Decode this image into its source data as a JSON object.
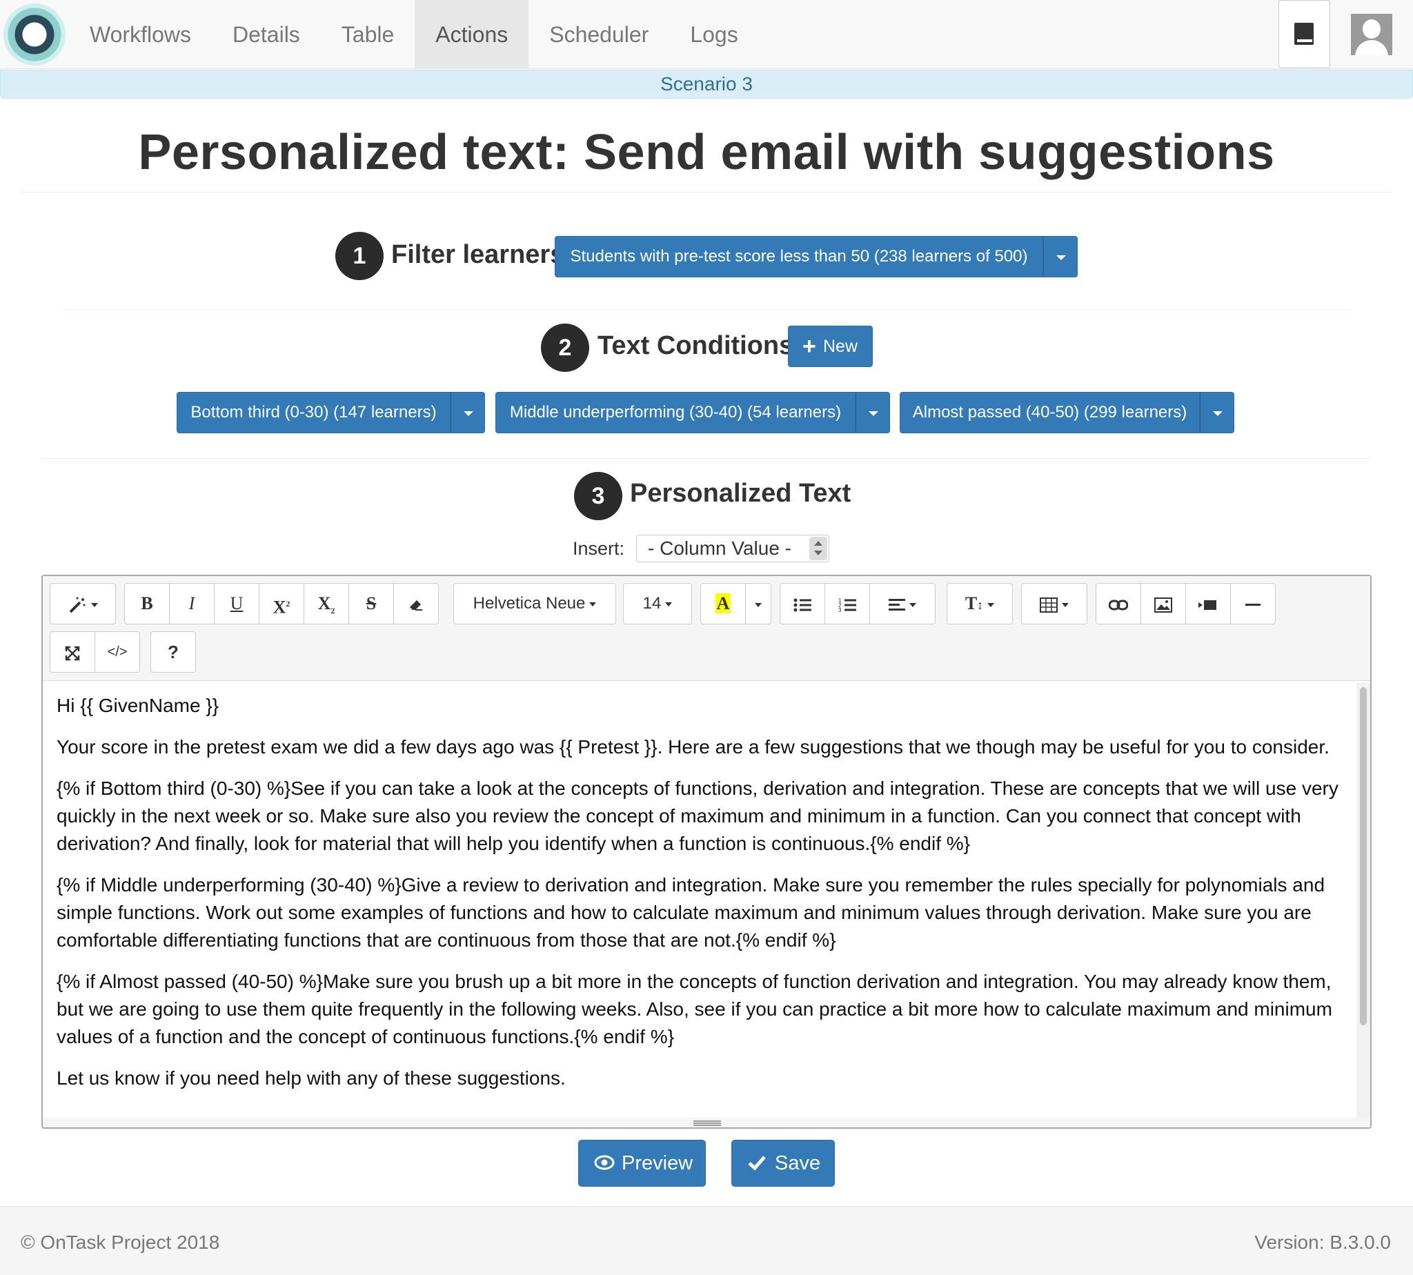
{
  "nav": {
    "items": [
      {
        "label": "Workflows",
        "active": false
      },
      {
        "label": "Details",
        "active": false
      },
      {
        "label": "Table",
        "active": false
      },
      {
        "label": "Actions",
        "active": true
      },
      {
        "label": "Scheduler",
        "active": false
      },
      {
        "label": "Logs",
        "active": false
      }
    ],
    "icons": {
      "logo": "ontask-logo",
      "book": "book-icon",
      "user": "user-avatar-icon"
    }
  },
  "scenario": "Scenario 3",
  "page_title": "Personalized text: Send email with suggestions",
  "steps": {
    "filter": {
      "number": "1",
      "label": "Filter learners",
      "button": "Students with pre-test score less than 50 (238 learners of 500)"
    },
    "conditions": {
      "number": "2",
      "label": "Text Conditions",
      "new_button": "New",
      "items": [
        "Bottom third (0-30) (147 learners)",
        "Middle underperforming (30-40) (54 learners)",
        "Almost passed (40-50) (299 learners)"
      ]
    },
    "text": {
      "number": "3",
      "label": "Personalized Text"
    }
  },
  "insert": {
    "label": "Insert:",
    "select_value": "- Column Value -"
  },
  "toolbar": {
    "font_name": "Helvetica Neue",
    "font_size": "14",
    "bold": "B",
    "italic": "I",
    "underline": "U",
    "superscript": "X",
    "subscript": "X",
    "text_color": "A",
    "help": "?",
    "code": "</>",
    "accent_highlight": "#ffff00"
  },
  "editor": {
    "paragraphs": [
      "Hi {{ GivenName }}",
      "Your score in the pretest exam we did a few days ago was {{ Pretest }}. Here are a few suggestions that we though may be useful for you to consider.",
      "{% if Bottom third (0-30) %}See if you can take a look at the concepts of functions, derivation and integration. These are concepts that we will use very quickly in the next week or so. Make sure also you review the concept of maximum and minimum in a function. Can you connect that concept with derivation? And finally, look for material that will help you identify when a function is continuous.{% endif %}",
      "{% if Middle underperforming (30-40) %}Give a review to derivation and integration. Make sure you remember the rules specially for polynomials and simple functions. Work out some examples of functions and how to calculate maximum and minimum values through derivation. Make sure you are comfortable differentiating functions that are continuous from those that are not.{% endif %}",
      "{% if Almost passed (40-50) %}Make sure you brush up a bit more in the concepts of function derivation and integration. You may already know them, but we are going to use them quite frequently in the following weeks. Also, see if you can practice a bit more how to calculate maximum and minimum values of a function and the concept of continuous functions.{% endif %}",
      "Let us know if you need help with any of these suggestions."
    ]
  },
  "actions": {
    "preview": "Preview",
    "save": "Save"
  },
  "footer": {
    "copyright": "© OnTask Project 2018",
    "version": "Version: B.3.0.0"
  },
  "colors": {
    "primary": "#337ab7",
    "scenario_bg": "#d9edf7",
    "scenario_text": "#31708f",
    "step_circle": "#2b2b2b"
  }
}
